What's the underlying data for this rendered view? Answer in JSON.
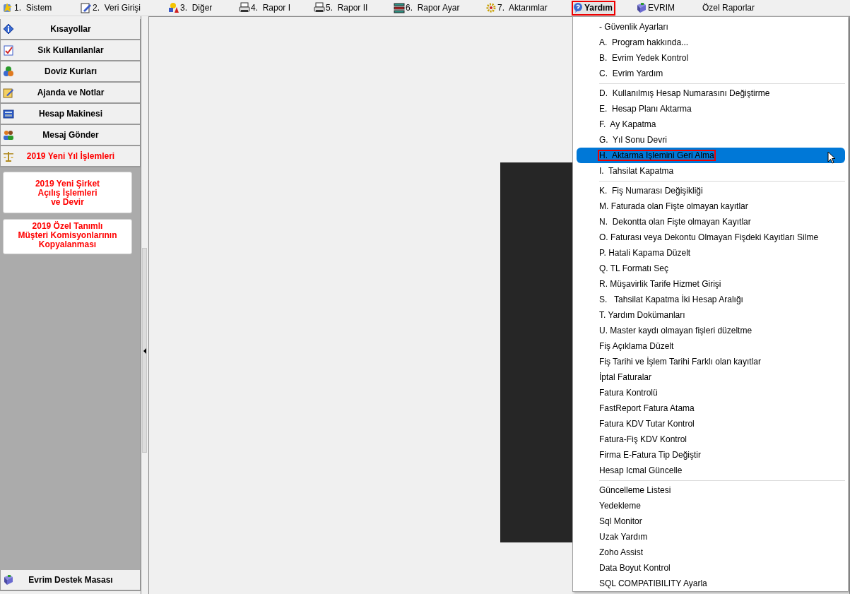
{
  "menubar": [
    {
      "label": "1.  Sistem",
      "selected": false,
      "annotated": false
    },
    {
      "label": "2.  Veri Girişi",
      "selected": false,
      "annotated": false
    },
    {
      "label": "3.  Diğer",
      "selected": false,
      "annotated": false
    },
    {
      "label": "4.  Rapor I",
      "selected": false,
      "annotated": false
    },
    {
      "label": "5.  Rapor II",
      "selected": false,
      "annotated": false
    },
    {
      "label": "6.  Rapor Ayar",
      "selected": false,
      "annotated": false
    },
    {
      "label": "7.  Aktarımlar",
      "selected": false,
      "annotated": false
    },
    {
      "label": "Yardım",
      "selected": true,
      "annotated": true
    },
    {
      "label": "EVRIM",
      "selected": false,
      "annotated": false
    },
    {
      "label": "Özel Raporlar",
      "selected": false,
      "annotated": false
    }
  ],
  "sidebar": {
    "items": [
      {
        "label": "Kısayollar",
        "color": "#000000"
      },
      {
        "label": "Sık Kullanılanlar",
        "color": "#000000"
      },
      {
        "label": "Doviz Kurları",
        "color": "#000000"
      },
      {
        "label": "Ajanda ve Notlar",
        "color": "#000000"
      },
      {
        "label": "Hesap Makinesi",
        "color": "#000000"
      },
      {
        "label": "Mesaj Gönder",
        "color": "#000000"
      },
      {
        "label": "2019 Yeni Yıl İşlemleri",
        "color": "#ff0000",
        "children": [
          {
            "label": "2019 Yeni Şirket\nAçılış İşlemleri\nve Devir"
          },
          {
            "label": "2019 Özel Tanımlı\nMüşteri Komisyonlarının\nKopyalanması"
          }
        ]
      }
    ],
    "footer_items": [
      {
        "label": "Evrim Destek Masası"
      }
    ]
  },
  "menu": {
    "groups": [
      {
        "items": [
          {
            "label": "- Güvenlik Ayarları",
            "selected": false,
            "annotated": false
          },
          {
            "label": "A.  Program hakkında...",
            "selected": false,
            "annotated": false
          },
          {
            "label": "B.  Evrim Yedek Kontrol",
            "selected": false,
            "annotated": false
          },
          {
            "label": "C.  Evrim Yardım",
            "selected": false,
            "annotated": false
          }
        ]
      },
      {
        "items": [
          {
            "label": "D.  Kullanılmış Hesap Numarasını Değiştirme",
            "selected": false,
            "annotated": false
          },
          {
            "label": "E.  Hesap Planı Aktarma",
            "selected": false,
            "annotated": false
          },
          {
            "label": "F.  Ay Kapatma",
            "selected": false,
            "annotated": false
          },
          {
            "label": "G.  Yıl Sonu Devri",
            "selected": false,
            "annotated": false
          },
          {
            "label": "H.  Aktarma İşlemini Geri Alma",
            "selected": true,
            "annotated": true
          },
          {
            "label": "I.  Tahsilat Kapatma",
            "selected": false,
            "annotated": false
          }
        ]
      },
      {
        "items": [
          {
            "label": "K.  Fiş Numarası Değişikliği",
            "selected": false,
            "annotated": false
          },
          {
            "label": "M. Faturada olan Fişte olmayan kayıtlar",
            "selected": false,
            "annotated": false
          },
          {
            "label": "N.  Dekontta olan Fişte olmayan Kayıtlar",
            "selected": false,
            "annotated": false
          },
          {
            "label": "O. Faturası veya Dekontu Olmayan Fişdeki Kayıtları Silme",
            "selected": false,
            "annotated": false
          },
          {
            "label": "P. Hatali Kapama Düzelt",
            "selected": false,
            "annotated": false
          },
          {
            "label": "Q. TL Formatı Seç",
            "selected": false,
            "annotated": false
          },
          {
            "label": "R. Müşavirlik Tarife Hizmet Girişi",
            "selected": false,
            "annotated": false
          },
          {
            "label": "S.   Tahsilat Kapatma İki Hesap Aralığı",
            "selected": false,
            "annotated": false
          },
          {
            "label": "T. Yardım Dokümanları",
            "selected": false,
            "annotated": false
          },
          {
            "label": "U. Master kaydı olmayan fişleri düzeltme",
            "selected": false,
            "annotated": false
          },
          {
            "label": "Fiş Açıklama Düzelt",
            "selected": false,
            "annotated": false
          },
          {
            "label": "Fiş Tarihi ve İşlem Tarihi Farklı olan kayıtlar",
            "selected": false,
            "annotated": false
          },
          {
            "label": "İptal Faturalar",
            "selected": false,
            "annotated": false
          },
          {
            "label": "Fatura Kontrolü",
            "selected": false,
            "annotated": false
          },
          {
            "label": "FastReport Fatura Atama",
            "selected": false,
            "annotated": false
          },
          {
            "label": "Fatura KDV Tutar Kontrol",
            "selected": false,
            "annotated": false
          },
          {
            "label": "Fatura-Fiş KDV Kontrol",
            "selected": false,
            "annotated": false
          },
          {
            "label": "Firma E-Fatura Tip Değiştir",
            "selected": false,
            "annotated": false
          },
          {
            "label": "Hesap Icmal Güncelle",
            "selected": false,
            "annotated": false
          }
        ]
      },
      {
        "items": [
          {
            "label": "Güncelleme Listesi",
            "selected": false,
            "annotated": false
          },
          {
            "label": "Yedekleme",
            "selected": false,
            "annotated": false
          },
          {
            "label": "Sql Monitor",
            "selected": false,
            "annotated": false
          },
          {
            "label": "Uzak Yardım",
            "selected": false,
            "annotated": false
          },
          {
            "label": "Zoho Assist",
            "selected": false,
            "annotated": false
          },
          {
            "label": "Data Boyut Kontrol",
            "selected": false,
            "annotated": false
          },
          {
            "label": "SQL COMPATIBILITY Ayarla",
            "selected": false,
            "annotated": false
          }
        ]
      }
    ]
  }
}
